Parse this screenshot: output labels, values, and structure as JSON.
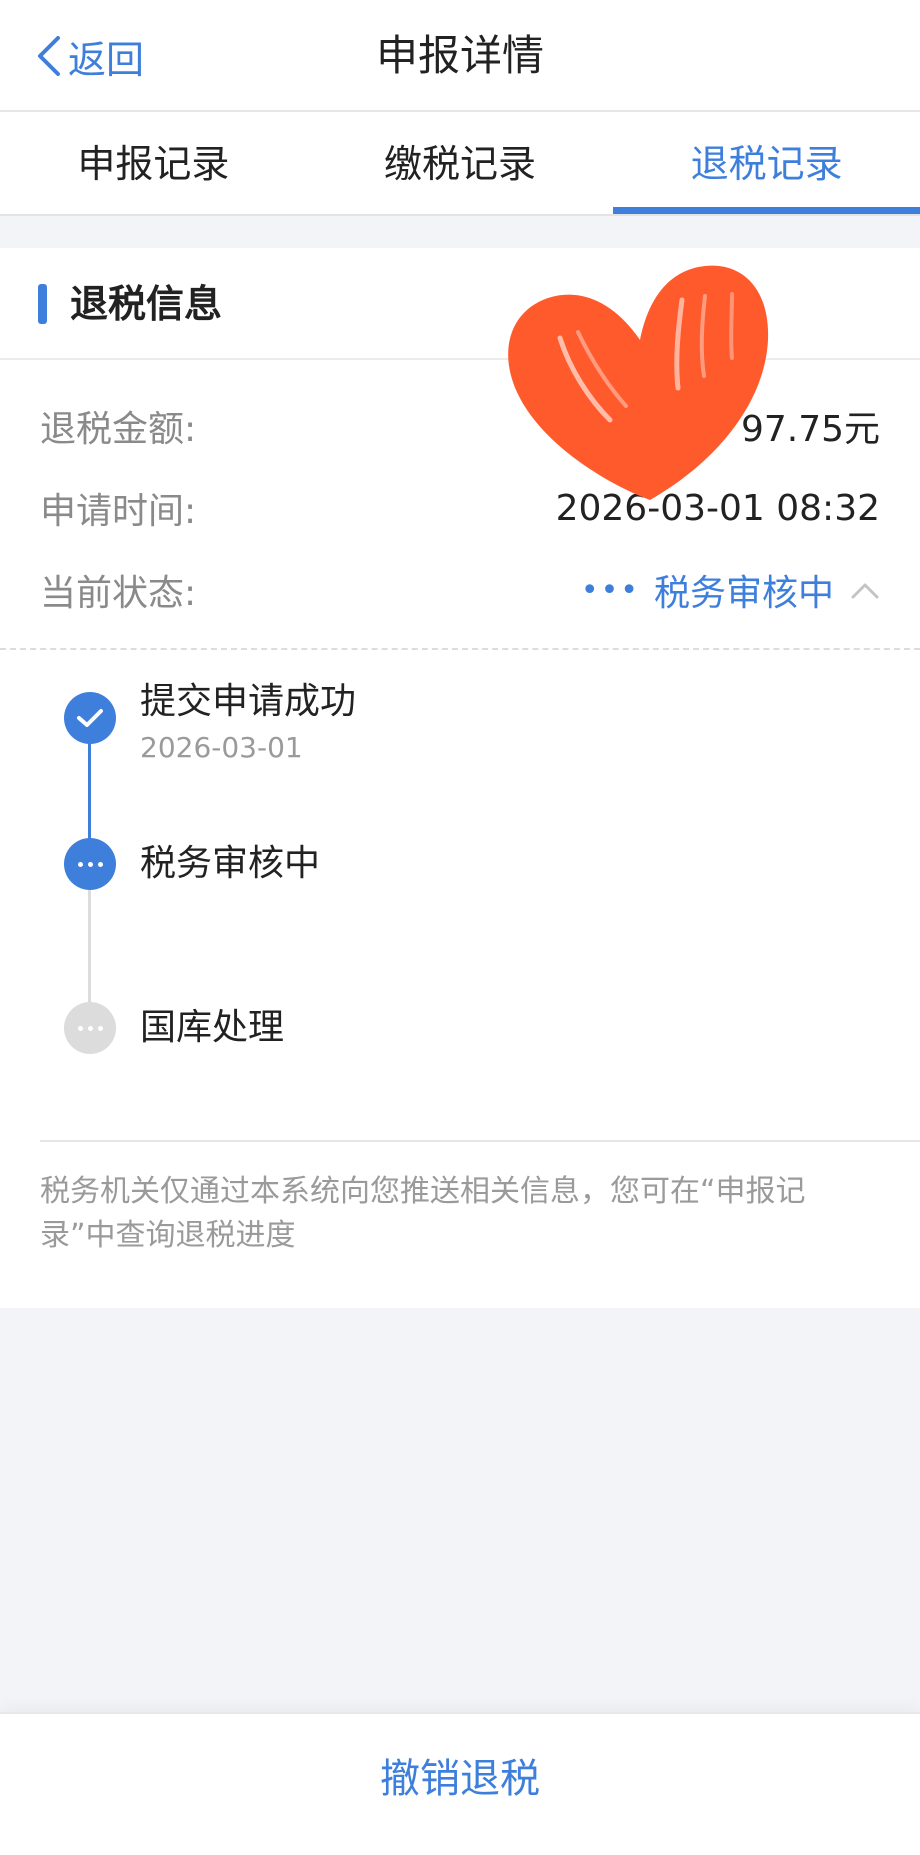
{
  "header": {
    "back_label": "返回",
    "title": "申报详情"
  },
  "tabs": [
    {
      "label": "申报记录",
      "active": false
    },
    {
      "label": "缴税记录",
      "active": false
    },
    {
      "label": "退税记录",
      "active": true
    }
  ],
  "refund": {
    "section_title": "退税信息",
    "amount_label": "退税金额:",
    "amount_value": "97.75元",
    "time_label": "申请时间:",
    "time_value": "2026-03-01 08:32",
    "status_label": "当前状态:",
    "status_value": "税务审核中"
  },
  "timeline": [
    {
      "title": "提交申请成功",
      "date": "2026-03-01",
      "state": "done"
    },
    {
      "title": "税务审核中",
      "date": "",
      "state": "current"
    },
    {
      "title": "国库处理",
      "date": "",
      "state": "pending"
    }
  ],
  "notice": "税务机关仅通过本系统向您推送相关信息，您可在“申报记录”中查询退税进度",
  "bottom": {
    "cancel_label": "撤销退税"
  },
  "colors": {
    "accent": "#3f7fdc",
    "heart": "#ff5a2c"
  },
  "icons": [
    "back-chevron-icon",
    "check-icon",
    "more-dots-icon",
    "chevron-up-icon",
    "heart-sticker"
  ]
}
